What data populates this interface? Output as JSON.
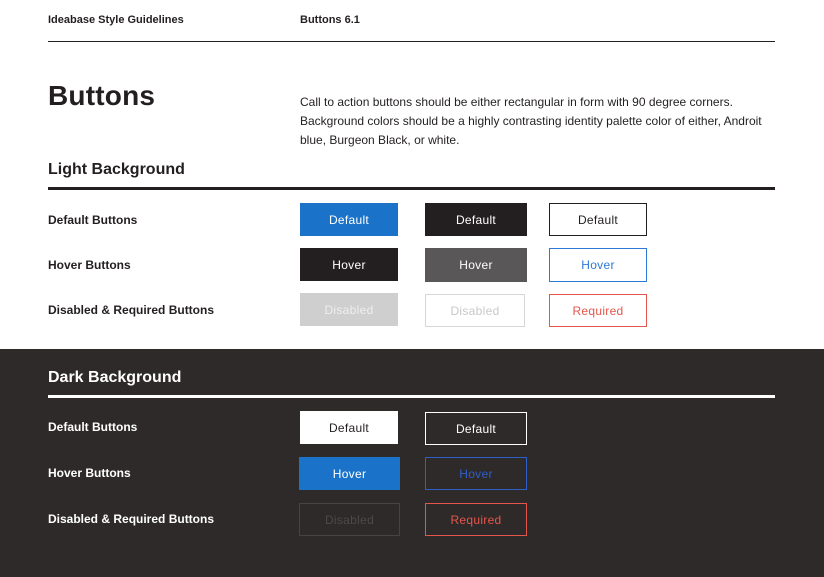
{
  "header": {
    "left": "Ideabase Style Guidelines",
    "right": "Buttons 6.1"
  },
  "page": {
    "title": "Buttons",
    "intro": "Call to action buttons should be either rectangular in form with 90 degree corners. Background colors should be a highly contrasting identity palette color of either, Androit blue, Burgeon Black, or white."
  },
  "colors": {
    "androit_blue": "#1a73c9",
    "burgeon_black": "#231f20",
    "hover_grey": "#5a5758",
    "disabled_grey": "#cfcfcf",
    "required_red": "#e5554b",
    "dark_background": "#2f2a2a"
  },
  "light": {
    "title": "Light Background",
    "rows": [
      {
        "label": "Default Buttons",
        "buttons": [
          "Default",
          "Default",
          "Default"
        ]
      },
      {
        "label": "Hover Buttons",
        "buttons": [
          "Hover",
          "Hover",
          "Hover"
        ]
      },
      {
        "label": "Disabled & Required Buttons",
        "buttons": [
          "Disabled",
          "Disabled",
          "Required"
        ]
      }
    ]
  },
  "dark": {
    "title": "Dark Background",
    "rows": [
      {
        "label": "Default Buttons",
        "buttons": [
          "Default",
          "Default"
        ]
      },
      {
        "label": "Hover Buttons",
        "buttons": [
          "Hover",
          "Hover"
        ]
      },
      {
        "label": "Disabled & Required Buttons",
        "buttons": [
          "Disabled",
          "Required"
        ]
      }
    ]
  }
}
